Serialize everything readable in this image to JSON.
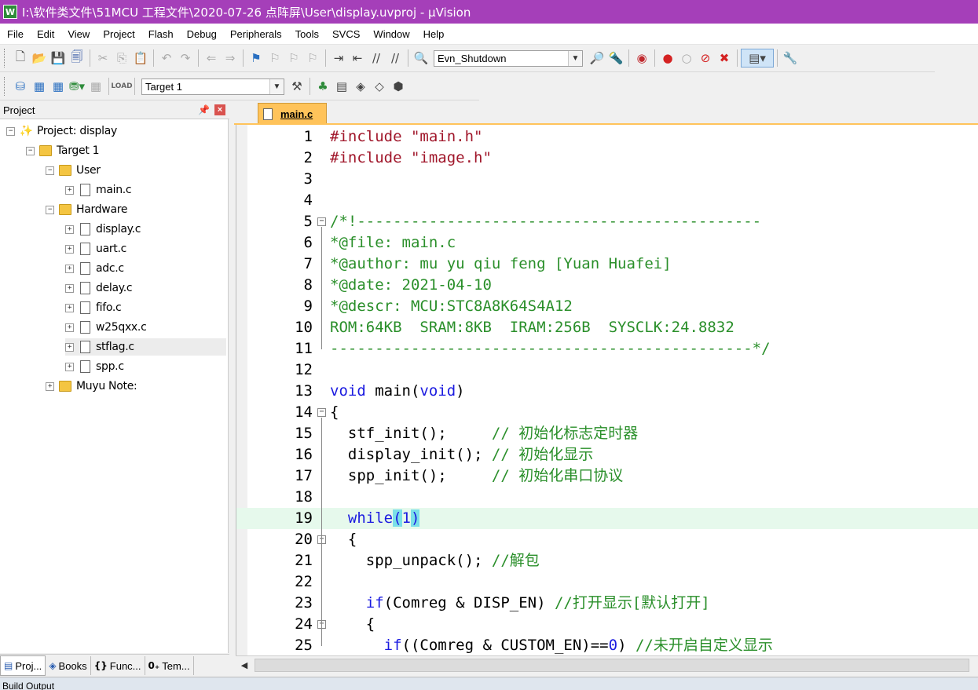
{
  "window": {
    "title": "I:\\软件类文件\\51MCU 工程文件\\2020-07-26 点阵屏\\User\\display.uvproj - µVision",
    "app_icon_letter": "W"
  },
  "menu": [
    "File",
    "Edit",
    "View",
    "Project",
    "Flash",
    "Debug",
    "Peripherals",
    "Tools",
    "SVCS",
    "Window",
    "Help"
  ],
  "toolbar1": {
    "find_combo_value": "Evn_Shutdown"
  },
  "toolbar2": {
    "target_combo_value": "Target 1"
  },
  "project_panel": {
    "title": "Project",
    "tree": [
      {
        "label": "Project: display",
        "depth": 0,
        "kind": "project",
        "expander": "−"
      },
      {
        "label": "Target 1",
        "depth": 1,
        "kind": "target",
        "expander": "−"
      },
      {
        "label": "User",
        "depth": 2,
        "kind": "folder",
        "expander": "−"
      },
      {
        "label": "main.c",
        "depth": 3,
        "kind": "file",
        "expander": "+"
      },
      {
        "label": "Hardware",
        "depth": 2,
        "kind": "folder",
        "expander": "−"
      },
      {
        "label": "display.c",
        "depth": 3,
        "kind": "file",
        "expander": "+"
      },
      {
        "label": "uart.c",
        "depth": 3,
        "kind": "file",
        "expander": "+"
      },
      {
        "label": "adc.c",
        "depth": 3,
        "kind": "file",
        "expander": "+"
      },
      {
        "label": "delay.c",
        "depth": 3,
        "kind": "file",
        "expander": "+"
      },
      {
        "label": "fifo.c",
        "depth": 3,
        "kind": "file",
        "expander": "+"
      },
      {
        "label": "w25qxx.c",
        "depth": 3,
        "kind": "file",
        "expander": "+"
      },
      {
        "label": "stflag.c",
        "depth": 3,
        "kind": "file",
        "expander": "+",
        "selected": true
      },
      {
        "label": "spp.c",
        "depth": 3,
        "kind": "file",
        "expander": "+"
      },
      {
        "label": "Muyu Note:",
        "depth": 2,
        "kind": "folder",
        "expander": "+"
      }
    ],
    "bottom_tabs": [
      {
        "label": "Proj...",
        "icon": "▤"
      },
      {
        "label": "Books",
        "icon": "◈"
      },
      {
        "label": "Func...",
        "icon": "{}"
      },
      {
        "label": "Tem...",
        "icon": "0₊"
      }
    ]
  },
  "editor": {
    "active_tab": "main.c",
    "current_line": 19,
    "lines": [
      {
        "n": "1",
        "segs": [
          [
            "pp",
            "#include "
          ],
          [
            "str",
            "\"main.h\""
          ]
        ]
      },
      {
        "n": "2",
        "segs": [
          [
            "pp",
            "#include "
          ],
          [
            "str",
            "\"image.h\""
          ]
        ]
      },
      {
        "n": "3",
        "segs": []
      },
      {
        "n": "4",
        "segs": []
      },
      {
        "n": "5",
        "fold": "−",
        "segs": [
          [
            "cm",
            "/*!---------------------------------------------"
          ]
        ]
      },
      {
        "n": "6",
        "segs": [
          [
            "cm",
            "*@file: main.c"
          ]
        ]
      },
      {
        "n": "7",
        "segs": [
          [
            "cm",
            "*@author: mu yu qiu feng [Yuan Huafei]"
          ]
        ]
      },
      {
        "n": "8",
        "segs": [
          [
            "cm",
            "*@date: 2021-04-10"
          ]
        ]
      },
      {
        "n": "9",
        "segs": [
          [
            "cm",
            "*@descr: MCU:STC8A8K64S4A12"
          ]
        ]
      },
      {
        "n": "10",
        "segs": [
          [
            "cm",
            "ROM:64KB  SRAM:8KB  IRAM:256B  SYSCLK:24.8832"
          ]
        ]
      },
      {
        "n": "11",
        "segs": [
          [
            "cm",
            "-----------------------------------------------*/"
          ]
        ]
      },
      {
        "n": "12",
        "segs": []
      },
      {
        "n": "13",
        "segs": [
          [
            "kw",
            "void"
          ],
          [
            "",
            " main("
          ],
          [
            "kw",
            "void"
          ],
          [
            "",
            ")"
          ]
        ]
      },
      {
        "n": "14",
        "fold": "−",
        "segs": [
          [
            "",
            "{"
          ]
        ]
      },
      {
        "n": "15",
        "segs": [
          [
            "",
            "  stf_init();     "
          ],
          [
            "cm",
            "// 初始化标志定时器"
          ]
        ]
      },
      {
        "n": "16",
        "segs": [
          [
            "",
            "  display_init(); "
          ],
          [
            "cm",
            "// 初始化显示"
          ]
        ]
      },
      {
        "n": "17",
        "segs": [
          [
            "",
            "  spp_init();     "
          ],
          [
            "cm",
            "// 初始化串口协议"
          ]
        ]
      },
      {
        "n": "18",
        "segs": []
      },
      {
        "n": "19",
        "segs": [
          [
            "kw",
            "  while"
          ],
          [
            "hl",
            "("
          ],
          [
            "num",
            "1"
          ],
          [
            "hl",
            ")"
          ]
        ]
      },
      {
        "n": "20",
        "fold": "−",
        "segs": [
          [
            "",
            "  {"
          ]
        ]
      },
      {
        "n": "21",
        "segs": [
          [
            "",
            "    spp_unpack(); "
          ],
          [
            "cm",
            "//解包"
          ]
        ]
      },
      {
        "n": "22",
        "segs": []
      },
      {
        "n": "23",
        "segs": [
          [
            "kw",
            "    if"
          ],
          [
            "",
            "(Comreg & DISP_EN) "
          ],
          [
            "cm",
            "//打开显示[默认打开]"
          ]
        ]
      },
      {
        "n": "24",
        "fold": "−",
        "segs": [
          [
            "",
            "    {"
          ]
        ]
      },
      {
        "n": "25",
        "segs": [
          [
            "kw",
            "      if"
          ],
          [
            "",
            "((Comreg & CUSTOM_EN)=="
          ],
          [
            "num",
            "0"
          ],
          [
            "",
            ") "
          ],
          [
            "cm",
            "//未开启自定义显示"
          ]
        ]
      }
    ]
  },
  "build_output": {
    "title": "Build Output"
  }
}
